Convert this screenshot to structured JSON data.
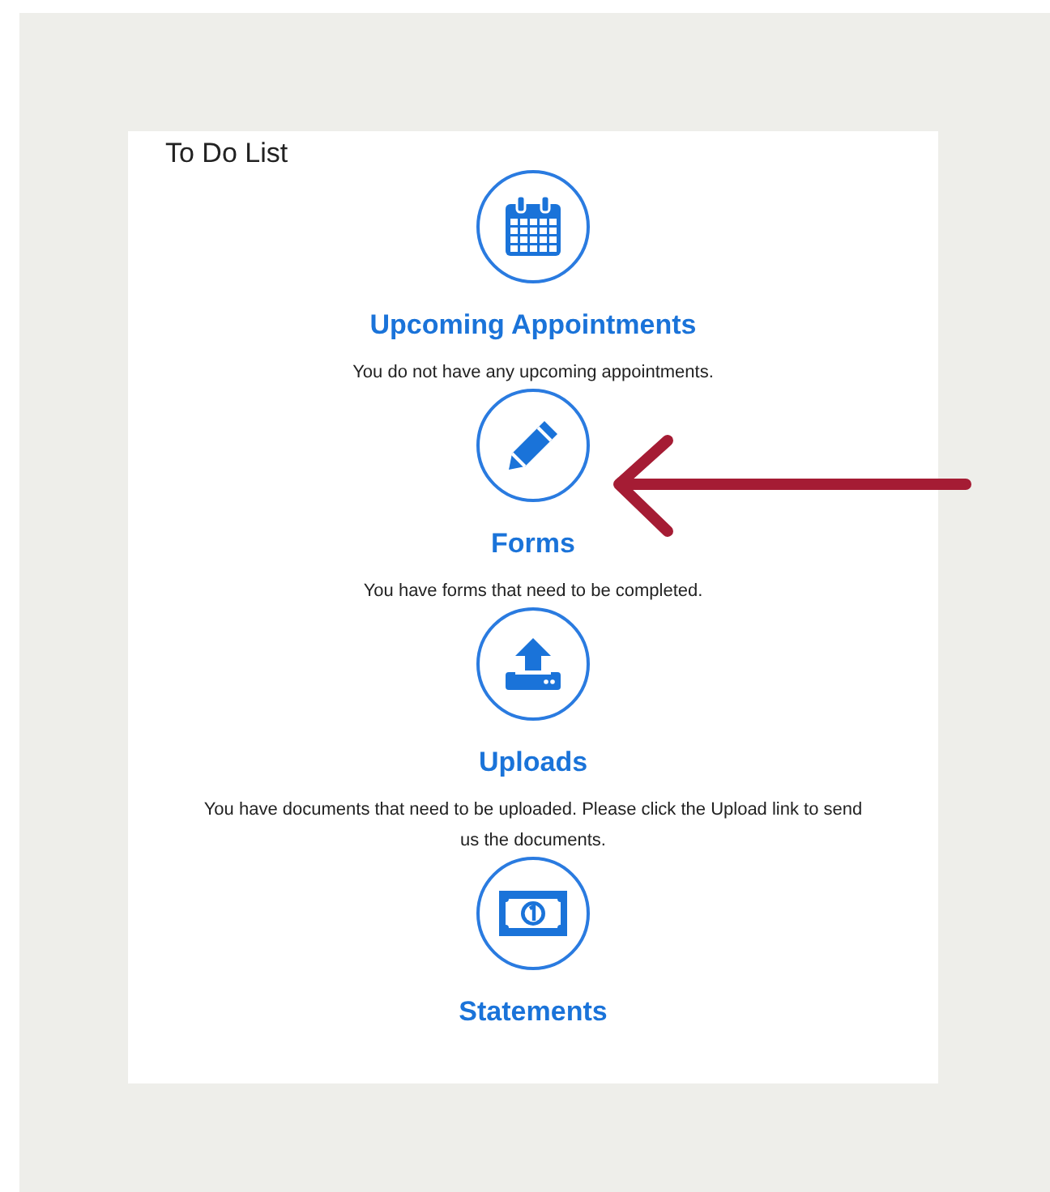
{
  "card": {
    "title": "To Do List"
  },
  "items": [
    {
      "kind": "calendar",
      "heading": "Upcoming Appointments",
      "description": "You do not have any upcoming appointments."
    },
    {
      "kind": "pencil",
      "heading": "Forms",
      "description": "You have forms that need to be completed."
    },
    {
      "kind": "upload",
      "heading": "Uploads",
      "description": "You have documents that need to be uploaded. Please click the Upload link to send us the documents."
    },
    {
      "kind": "money",
      "heading": "Statements"
    }
  ],
  "annotation": {
    "kind": "arrow"
  }
}
